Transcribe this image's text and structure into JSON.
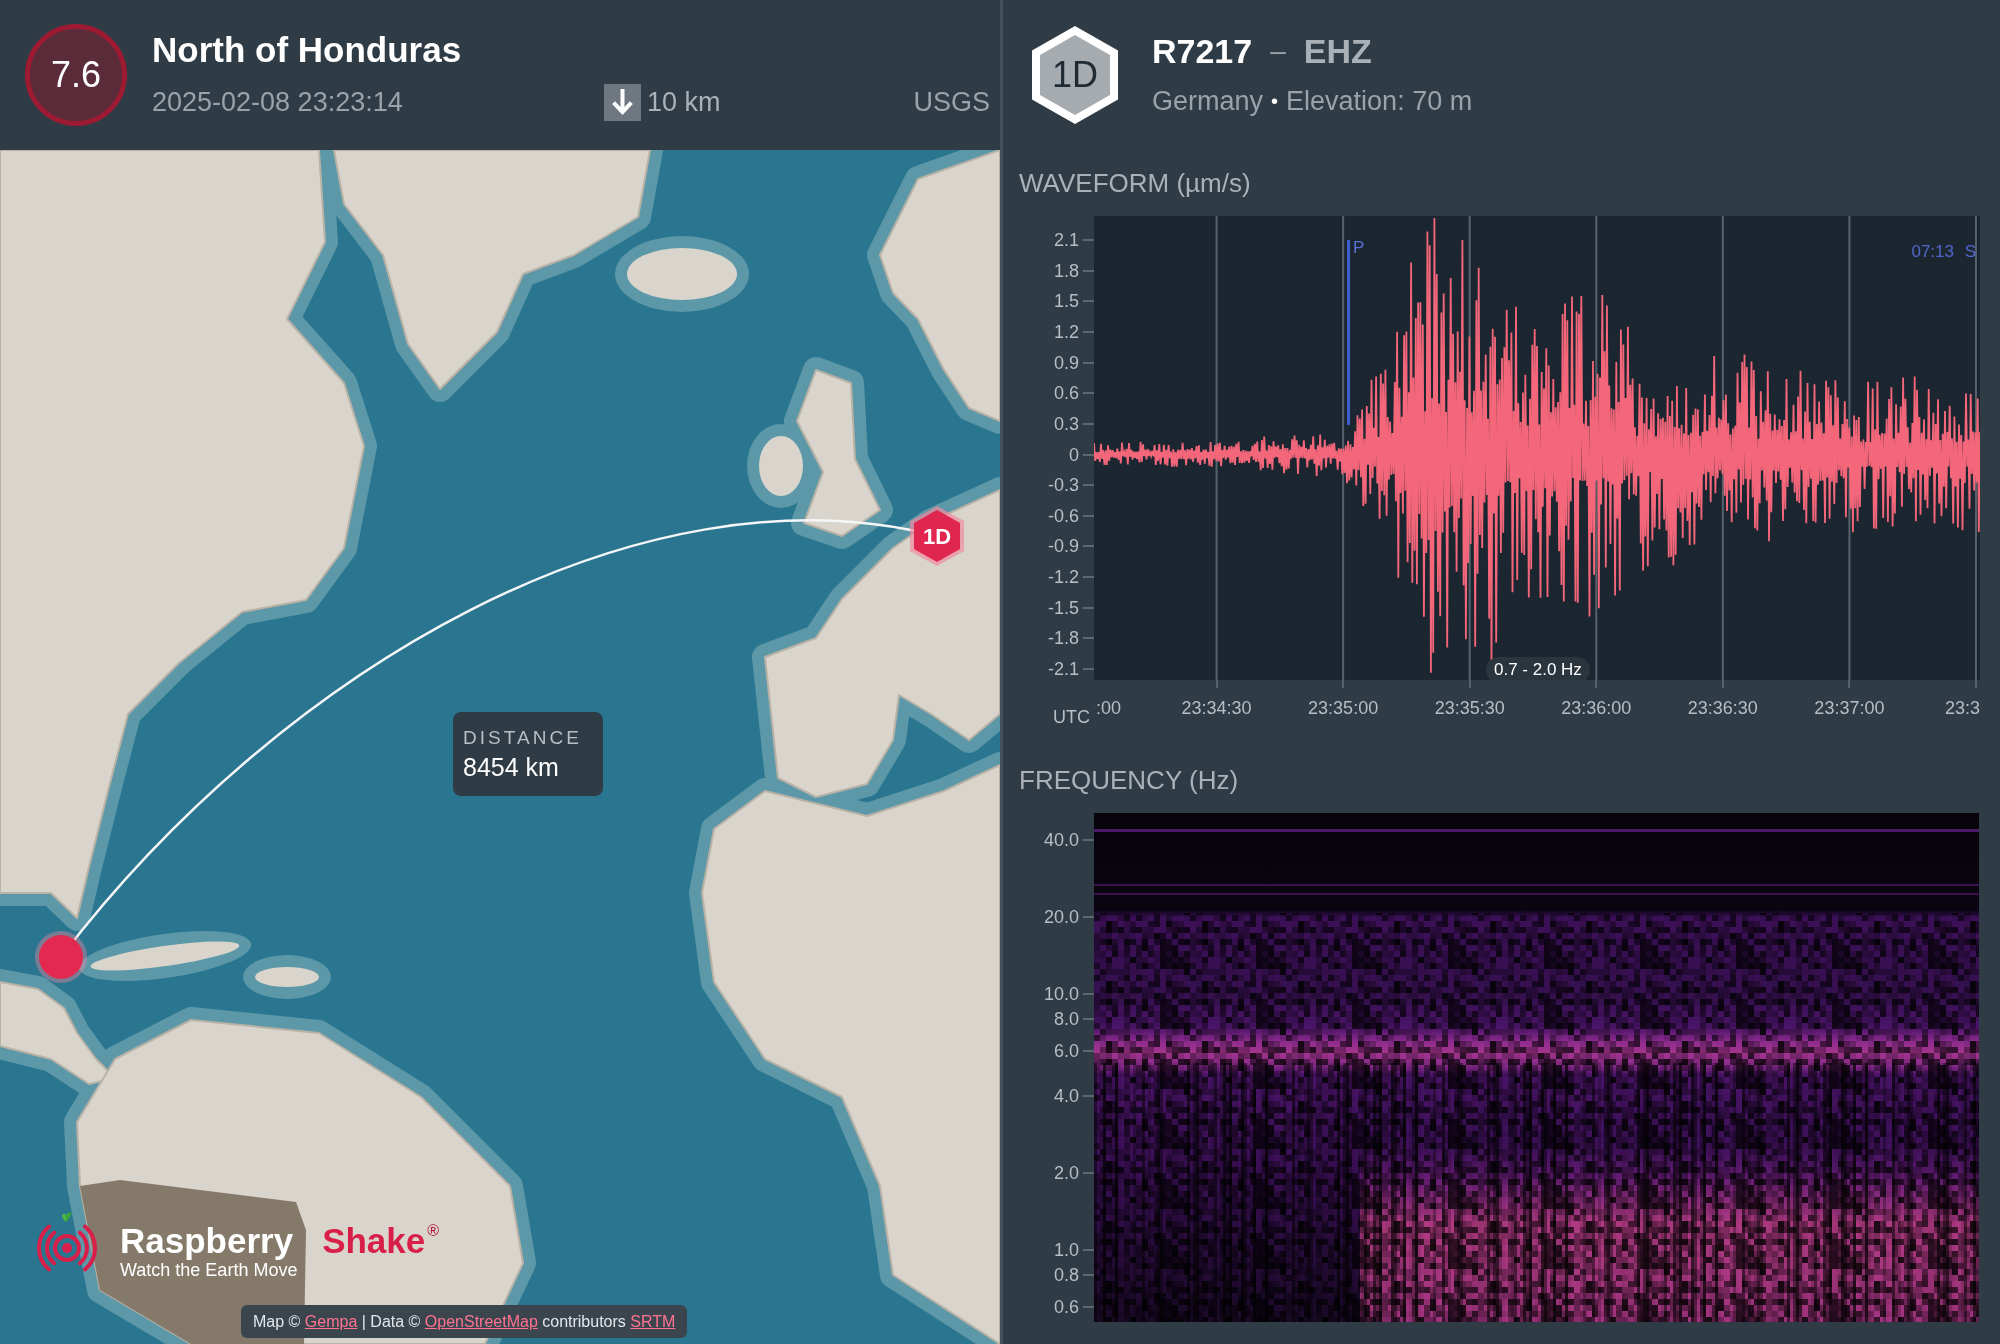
{
  "event": {
    "magnitude": "7.6",
    "region": "North of Honduras",
    "time": "2025-02-08 23:23:14",
    "depth": "10 km",
    "source": "USGS"
  },
  "map": {
    "distance_label": "DISTANCE",
    "distance": "8454 km",
    "station_marker": "1D",
    "logo": {
      "name": "Raspberry",
      "name_accent": "Shake",
      "registered": "®",
      "tagline": "Watch the Earth Move"
    },
    "attribution": [
      {
        "kind": "text",
        "text": "Map ©"
      },
      {
        "kind": "link",
        "text": "Gempa"
      },
      {
        "kind": "text",
        "text": "| Data ©"
      },
      {
        "kind": "link",
        "text": "OpenStreetMap"
      },
      {
        "kind": "text",
        "text": "contributors"
      },
      {
        "kind": "link",
        "text": "SRTM"
      }
    ]
  },
  "station": {
    "badge": "1D",
    "code": "R7217",
    "separator": "–",
    "channel": "EHZ",
    "country": "Germany",
    "bullet": "•",
    "elevation": "Elevation: 70 m"
  },
  "waveform": {
    "title": "WAVEFORM (µm/s)",
    "y_ticks": [
      "2.1",
      "1.8",
      "1.5",
      "1.2",
      "0.9",
      "0.6",
      "0.3",
      "0",
      "-0.3",
      "-0.6",
      "-0.9",
      "-1.2",
      "-1.5",
      "-1.8",
      "-2.1"
    ],
    "x_ticks": [
      ":00",
      "23:34:30",
      "23:35:00",
      "23:35:30",
      "23:36:00",
      "23:36:30",
      "23:37:00",
      "23:3"
    ],
    "time_zone": "UTC",
    "phase_markers": [
      {
        "kind": "line",
        "label": "P"
      },
      {
        "kind": "edge",
        "label": "S",
        "countdown": "07:13"
      }
    ],
    "filter": "0.7 - 2.0 Hz"
  },
  "frequency": {
    "title": "FREQUENCY (Hz)",
    "y_ticks": [
      "40.0",
      "20.0",
      "10.0",
      "8.0",
      "6.0",
      "4.0",
      "2.0",
      "1.0",
      "0.8",
      "0.6"
    ]
  }
}
